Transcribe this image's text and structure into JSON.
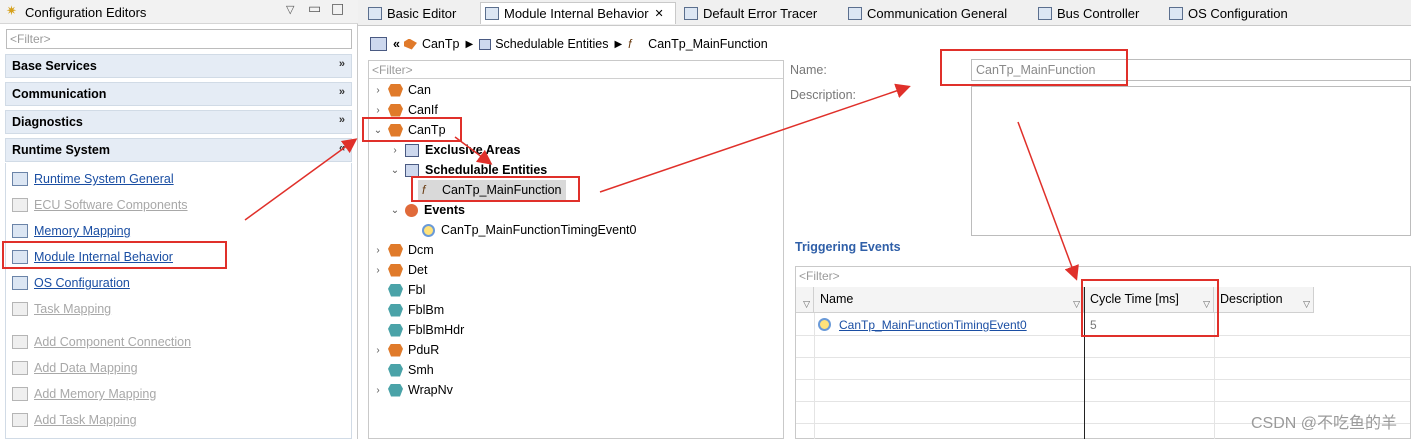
{
  "left_panel": {
    "title": "Configuration Editors",
    "filter_placeholder": "<Filter>",
    "categories": [
      "Base Services",
      "Communication",
      "Diagnostics",
      "Runtime System"
    ],
    "runtime_items": [
      {
        "label": "Runtime System General",
        "enabled": true
      },
      {
        "label": "ECU Software Components",
        "enabled": false
      },
      {
        "label": "Memory Mapping",
        "enabled": true
      },
      {
        "label": "Module Internal Behavior",
        "enabled": true
      },
      {
        "label": "OS Configuration",
        "enabled": true
      },
      {
        "label": "Task Mapping",
        "enabled": false
      },
      {
        "label": "Add Component Connection",
        "enabled": false
      },
      {
        "label": "Add Data Mapping",
        "enabled": false
      },
      {
        "label": "Add Memory Mapping",
        "enabled": false
      },
      {
        "label": "Add Task Mapping",
        "enabled": false
      }
    ]
  },
  "tabs": [
    {
      "label": "Basic Editor",
      "active": false
    },
    {
      "label": "Module Internal Behavior",
      "active": true
    },
    {
      "label": "Default Error Tracer",
      "active": false
    },
    {
      "label": "Communication General",
      "active": false
    },
    {
      "label": "Bus Controller",
      "active": false
    },
    {
      "label": "OS Configuration",
      "active": false
    }
  ],
  "breadcrumb": [
    "CanTp",
    "Schedulable Entities",
    "CanTp_MainFunction"
  ],
  "tree": {
    "filter_placeholder": "<Filter>",
    "modules": [
      "Can",
      "CanIf",
      "CanTp",
      "Exclusive Areas",
      "Schedulable Entities",
      "CanTp_MainFunction",
      "Events",
      "CanTp_MainFunctionTimingEvent0",
      "Dcm",
      "Det",
      "Fbl",
      "FblBm",
      "FblBmHdr",
      "PduR",
      "Smh",
      "WrapNv"
    ]
  },
  "form": {
    "name_label": "Name:",
    "name_value": "CanTp_MainFunction",
    "description_label": "Description:"
  },
  "triggering": {
    "title": "Triggering Events",
    "filter_placeholder": "<Filter>",
    "columns": [
      "Name",
      "Cycle Time [ms]",
      "Description"
    ],
    "rows": [
      {
        "name": "CanTp_MainFunctionTimingEvent0",
        "cycle_time": "5",
        "description": ""
      }
    ]
  },
  "watermark": "CSDN @不吃鱼的羊",
  "colors": {
    "annotation_red": "#e0302a",
    "link_blue": "#1a4ea3",
    "accent_blue": "#2f5fa8"
  }
}
